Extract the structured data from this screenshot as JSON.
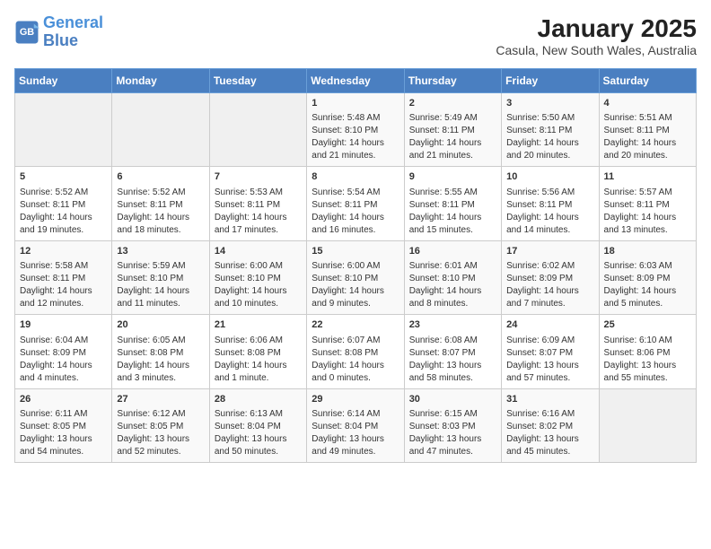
{
  "logo": {
    "line1": "General",
    "line2": "Blue"
  },
  "title": "January 2025",
  "subtitle": "Casula, New South Wales, Australia",
  "days_of_week": [
    "Sunday",
    "Monday",
    "Tuesday",
    "Wednesday",
    "Thursday",
    "Friday",
    "Saturday"
  ],
  "weeks": [
    [
      {
        "day": "",
        "sunrise": "",
        "sunset": "",
        "daylight": ""
      },
      {
        "day": "",
        "sunrise": "",
        "sunset": "",
        "daylight": ""
      },
      {
        "day": "",
        "sunrise": "",
        "sunset": "",
        "daylight": ""
      },
      {
        "day": "1",
        "sunrise": "Sunrise: 5:48 AM",
        "sunset": "Sunset: 8:10 PM",
        "daylight": "Daylight: 14 hours and 21 minutes."
      },
      {
        "day": "2",
        "sunrise": "Sunrise: 5:49 AM",
        "sunset": "Sunset: 8:11 PM",
        "daylight": "Daylight: 14 hours and 21 minutes."
      },
      {
        "day": "3",
        "sunrise": "Sunrise: 5:50 AM",
        "sunset": "Sunset: 8:11 PM",
        "daylight": "Daylight: 14 hours and 20 minutes."
      },
      {
        "day": "4",
        "sunrise": "Sunrise: 5:51 AM",
        "sunset": "Sunset: 8:11 PM",
        "daylight": "Daylight: 14 hours and 20 minutes."
      }
    ],
    [
      {
        "day": "5",
        "sunrise": "Sunrise: 5:52 AM",
        "sunset": "Sunset: 8:11 PM",
        "daylight": "Daylight: 14 hours and 19 minutes."
      },
      {
        "day": "6",
        "sunrise": "Sunrise: 5:52 AM",
        "sunset": "Sunset: 8:11 PM",
        "daylight": "Daylight: 14 hours and 18 minutes."
      },
      {
        "day": "7",
        "sunrise": "Sunrise: 5:53 AM",
        "sunset": "Sunset: 8:11 PM",
        "daylight": "Daylight: 14 hours and 17 minutes."
      },
      {
        "day": "8",
        "sunrise": "Sunrise: 5:54 AM",
        "sunset": "Sunset: 8:11 PM",
        "daylight": "Daylight: 14 hours and 16 minutes."
      },
      {
        "day": "9",
        "sunrise": "Sunrise: 5:55 AM",
        "sunset": "Sunset: 8:11 PM",
        "daylight": "Daylight: 14 hours and 15 minutes."
      },
      {
        "day": "10",
        "sunrise": "Sunrise: 5:56 AM",
        "sunset": "Sunset: 8:11 PM",
        "daylight": "Daylight: 14 hours and 14 minutes."
      },
      {
        "day": "11",
        "sunrise": "Sunrise: 5:57 AM",
        "sunset": "Sunset: 8:11 PM",
        "daylight": "Daylight: 14 hours and 13 minutes."
      }
    ],
    [
      {
        "day": "12",
        "sunrise": "Sunrise: 5:58 AM",
        "sunset": "Sunset: 8:11 PM",
        "daylight": "Daylight: 14 hours and 12 minutes."
      },
      {
        "day": "13",
        "sunrise": "Sunrise: 5:59 AM",
        "sunset": "Sunset: 8:10 PM",
        "daylight": "Daylight: 14 hours and 11 minutes."
      },
      {
        "day": "14",
        "sunrise": "Sunrise: 6:00 AM",
        "sunset": "Sunset: 8:10 PM",
        "daylight": "Daylight: 14 hours and 10 minutes."
      },
      {
        "day": "15",
        "sunrise": "Sunrise: 6:00 AM",
        "sunset": "Sunset: 8:10 PM",
        "daylight": "Daylight: 14 hours and 9 minutes."
      },
      {
        "day": "16",
        "sunrise": "Sunrise: 6:01 AM",
        "sunset": "Sunset: 8:10 PM",
        "daylight": "Daylight: 14 hours and 8 minutes."
      },
      {
        "day": "17",
        "sunrise": "Sunrise: 6:02 AM",
        "sunset": "Sunset: 8:09 PM",
        "daylight": "Daylight: 14 hours and 7 minutes."
      },
      {
        "day": "18",
        "sunrise": "Sunrise: 6:03 AM",
        "sunset": "Sunset: 8:09 PM",
        "daylight": "Daylight: 14 hours and 5 minutes."
      }
    ],
    [
      {
        "day": "19",
        "sunrise": "Sunrise: 6:04 AM",
        "sunset": "Sunset: 8:09 PM",
        "daylight": "Daylight: 14 hours and 4 minutes."
      },
      {
        "day": "20",
        "sunrise": "Sunrise: 6:05 AM",
        "sunset": "Sunset: 8:08 PM",
        "daylight": "Daylight: 14 hours and 3 minutes."
      },
      {
        "day": "21",
        "sunrise": "Sunrise: 6:06 AM",
        "sunset": "Sunset: 8:08 PM",
        "daylight": "Daylight: 14 hours and 1 minute."
      },
      {
        "day": "22",
        "sunrise": "Sunrise: 6:07 AM",
        "sunset": "Sunset: 8:08 PM",
        "daylight": "Daylight: 14 hours and 0 minutes."
      },
      {
        "day": "23",
        "sunrise": "Sunrise: 6:08 AM",
        "sunset": "Sunset: 8:07 PM",
        "daylight": "Daylight: 13 hours and 58 minutes."
      },
      {
        "day": "24",
        "sunrise": "Sunrise: 6:09 AM",
        "sunset": "Sunset: 8:07 PM",
        "daylight": "Daylight: 13 hours and 57 minutes."
      },
      {
        "day": "25",
        "sunrise": "Sunrise: 6:10 AM",
        "sunset": "Sunset: 8:06 PM",
        "daylight": "Daylight: 13 hours and 55 minutes."
      }
    ],
    [
      {
        "day": "26",
        "sunrise": "Sunrise: 6:11 AM",
        "sunset": "Sunset: 8:05 PM",
        "daylight": "Daylight: 13 hours and 54 minutes."
      },
      {
        "day": "27",
        "sunrise": "Sunrise: 6:12 AM",
        "sunset": "Sunset: 8:05 PM",
        "daylight": "Daylight: 13 hours and 52 minutes."
      },
      {
        "day": "28",
        "sunrise": "Sunrise: 6:13 AM",
        "sunset": "Sunset: 8:04 PM",
        "daylight": "Daylight: 13 hours and 50 minutes."
      },
      {
        "day": "29",
        "sunrise": "Sunrise: 6:14 AM",
        "sunset": "Sunset: 8:04 PM",
        "daylight": "Daylight: 13 hours and 49 minutes."
      },
      {
        "day": "30",
        "sunrise": "Sunrise: 6:15 AM",
        "sunset": "Sunset: 8:03 PM",
        "daylight": "Daylight: 13 hours and 47 minutes."
      },
      {
        "day": "31",
        "sunrise": "Sunrise: 6:16 AM",
        "sunset": "Sunset: 8:02 PM",
        "daylight": "Daylight: 13 hours and 45 minutes."
      },
      {
        "day": "",
        "sunrise": "",
        "sunset": "",
        "daylight": ""
      }
    ]
  ]
}
